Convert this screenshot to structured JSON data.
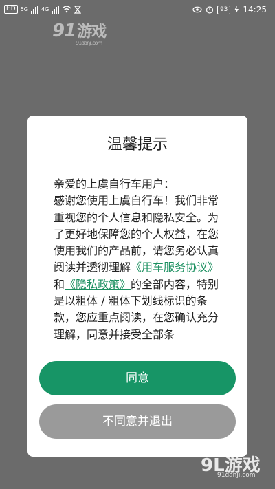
{
  "status_bar": {
    "left_chips": [
      "HD",
      "5G",
      "4G"
    ],
    "right_battery": "93",
    "time": "14:25",
    "icons": [
      "eye-icon",
      "alarm-icon",
      "charging-icon"
    ]
  },
  "watermark": {
    "top_logo": "91",
    "top_text": "游戏",
    "top_url": "91danji.com",
    "bottom_logo": "9L游戏",
    "bottom_url": "91danji.com"
  },
  "dialog": {
    "title": "温馨提示",
    "greeting": "亲爱的上虞自行车用户：",
    "body_intro": "感谢您使用上虞自行车！我们非常重视您的个人信息和隐私安全。为了更好地保障您的个人权益，在您使用我们的产品前，请您务必认真阅读并透彻理解",
    "link_service": "《用车服务协议》",
    "connector": "和",
    "link_privacy": "《隐私政策》",
    "body_rest": "的全部内容，特别是以粗体 / 粗体下划线标识的条款，您应重点阅读，在您确认充分理解，同意并接受全部条",
    "agree_button": "同意",
    "decline_button": "不同意并退出"
  },
  "colors": {
    "accent": "#179566",
    "link": "#1a8f5f",
    "decline": "#9a9a9a",
    "overlay": "#6b6b6b"
  }
}
